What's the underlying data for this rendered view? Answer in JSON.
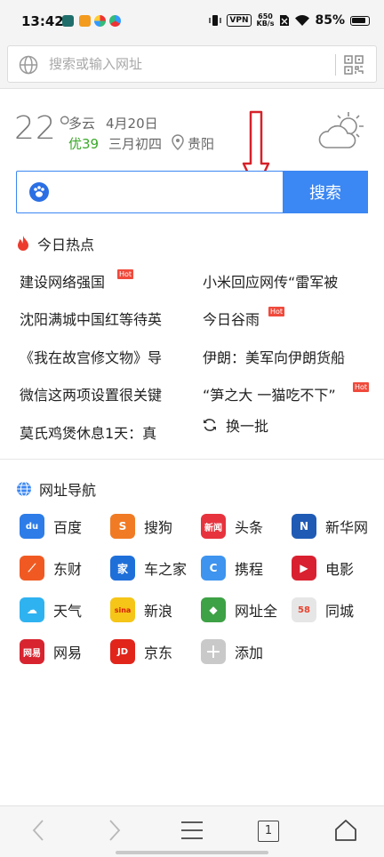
{
  "status_bar": {
    "time": "13:42",
    "vpn": "VPN",
    "speed_value": "650",
    "speed_unit": "KB/s",
    "battery": "85%"
  },
  "address_bar": {
    "placeholder": "搜索或输入网址"
  },
  "weather": {
    "temperature": "22°",
    "condition": "多云",
    "date": "4月20日",
    "aqi": "优39",
    "lunar_date": "三月初四",
    "city": "贵阳"
  },
  "search": {
    "button_label": "搜索"
  },
  "hot": {
    "title": "今日热点",
    "tag": "Hot",
    "items": [
      "建设网络强国",
      "小米回应网传“雷军被",
      "沈阳满城中国红等待英",
      "今日谷雨",
      "《我在故宫修文物》导",
      "伊朗：美军向伊朗货船",
      "微信这两项设置很关键",
      "“笋之大 一猫吃不下”",
      "莫氏鸡煲休息1天：真"
    ],
    "refresh_label": "换一批"
  },
  "nav": {
    "title": "网址导航",
    "items": [
      {
        "label": "百度",
        "icon_text": "du",
        "color": "#2d7ce8"
      },
      {
        "label": "搜狗",
        "icon_text": "S",
        "color": "#f07b24"
      },
      {
        "label": "头条",
        "icon_text": "新闻",
        "color": "#e7333d"
      },
      {
        "label": "新华网",
        "icon_text": "N",
        "color": "#1f5bb5"
      },
      {
        "label": "东财",
        "icon_text": "⟋",
        "color": "#f05a22"
      },
      {
        "label": "车之家",
        "icon_text": "家",
        "color": "#1f6fd9"
      },
      {
        "label": "携程",
        "icon_text": "C",
        "color": "#3e94ee"
      },
      {
        "label": "电影",
        "icon_text": "▶",
        "color": "#d92030"
      },
      {
        "label": "天气",
        "icon_text": "☁",
        "color": "#2fb2f0"
      },
      {
        "label": "新浪",
        "icon_text": "sina",
        "color": "#f5c518"
      },
      {
        "label": "网址全",
        "icon_text": "◆",
        "color": "#3da145"
      },
      {
        "label": "同城",
        "icon_text": "58",
        "color": "#e6e6e6"
      },
      {
        "label": "网易",
        "icon_text": "网易",
        "color": "#d7242f"
      },
      {
        "label": "京东",
        "icon_text": "JD",
        "color": "#e1251b"
      },
      {
        "label": "添加",
        "icon_text": "+",
        "color": "#c9c9c9"
      }
    ]
  },
  "bottom_bar": {
    "tab_count": "1"
  }
}
